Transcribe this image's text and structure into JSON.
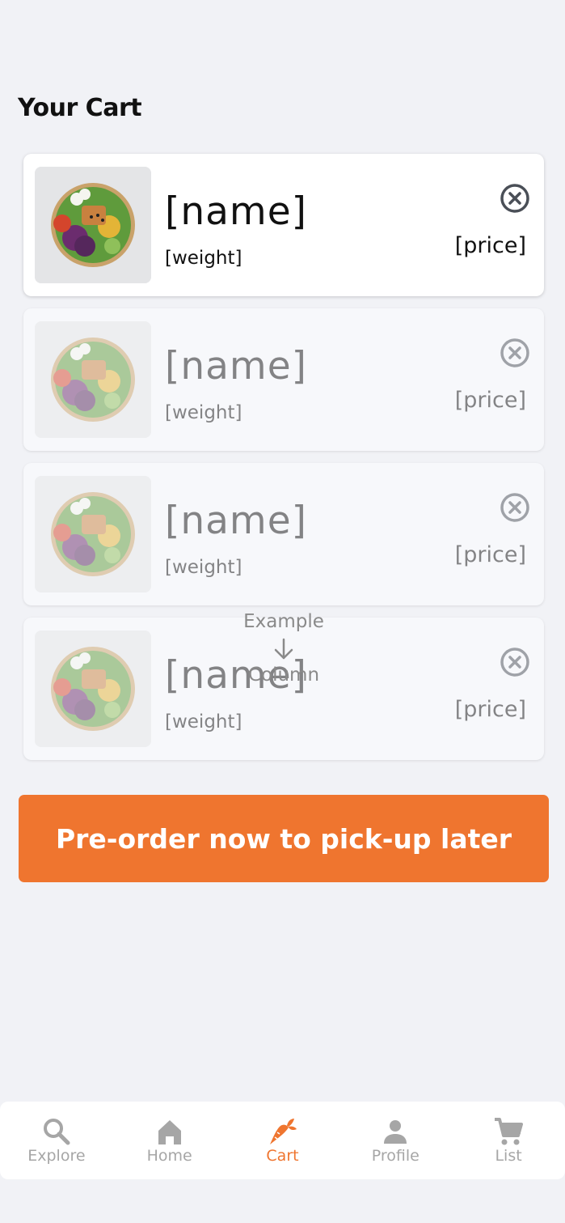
{
  "page": {
    "title": "Your Cart"
  },
  "colors": {
    "accent": "#ef752f",
    "text": "#111111",
    "muted": "#a6a6a6",
    "background": "#f1f2f6"
  },
  "cart_items": [
    {
      "name": "[name]",
      "weight": "[weight]",
      "price": "[price]",
      "remove_icon": "close-circle-icon"
    },
    {
      "name": "[name]",
      "weight": "[weight]",
      "price": "[price]",
      "remove_icon": "close-circle-icon"
    },
    {
      "name": "[name]",
      "weight": "[weight]",
      "price": "[price]",
      "remove_icon": "close-circle-icon"
    },
    {
      "name": "[name]",
      "weight": "[weight]",
      "price": "[price]",
      "remove_icon": "close-circle-icon"
    }
  ],
  "overlay": {
    "top": "Example",
    "bottom": "Column",
    "icon": "arrow-down-icon"
  },
  "cta": {
    "label": "Pre-order now to pick-up later"
  },
  "nav": {
    "items": [
      {
        "label": "Explore",
        "icon": "search-icon",
        "active": false
      },
      {
        "label": "Home",
        "icon": "home-icon",
        "active": false
      },
      {
        "label": "Cart",
        "icon": "carrot-icon",
        "active": true
      },
      {
        "label": "Profile",
        "icon": "person-icon",
        "active": false
      },
      {
        "label": "List",
        "icon": "shopping-cart-icon",
        "active": false
      }
    ]
  }
}
